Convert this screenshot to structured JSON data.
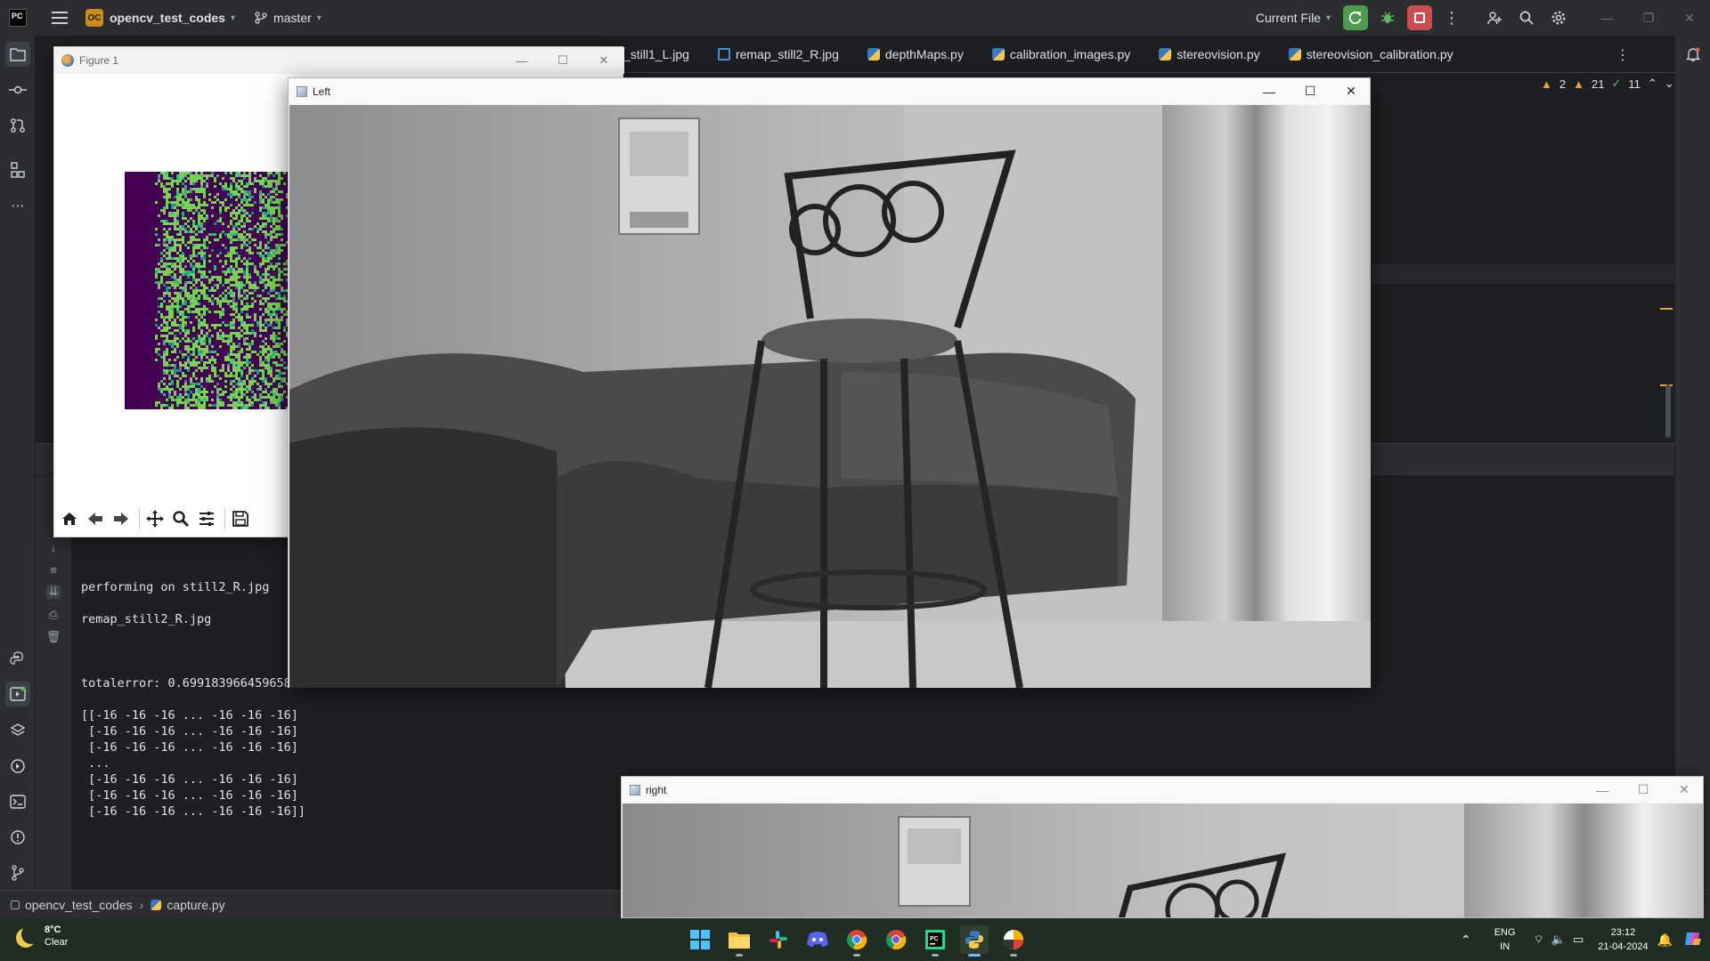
{
  "ide": {
    "logo_text": "PC",
    "project_badge": "OC",
    "project_name": "opencv_test_codes",
    "branch": "master",
    "run_config": "Current File",
    "tabs": [
      {
        "label": "_still1_L.jpg",
        "icon": "image-file-icon"
      },
      {
        "label": "remap_still2_R.jpg",
        "icon": "image-file-icon"
      },
      {
        "label": "depthMaps.py",
        "icon": "python-file-icon"
      },
      {
        "label": "calibration_images.py",
        "icon": "python-file-icon"
      },
      {
        "label": "stereovision.py",
        "icon": "python-file-icon"
      },
      {
        "label": "stereovision_calibration.py",
        "icon": "python-file-icon"
      }
    ],
    "inspections": {
      "warnings_a": "2",
      "warnings_b": "21",
      "ok": "11"
    },
    "project_panel_label": "P",
    "run_panel_label": "R",
    "colors": {
      "bg": "#1e1f22",
      "panel": "#2b2d30",
      "run_green": "#4e9a4e",
      "stop_red": "#c94f4f",
      "accent_warn": "#e5a33b"
    }
  },
  "console": {
    "lines": [
      "performing on still2_R.jpg",
      "",
      "remap_still2_R.jpg",
      "",
      "",
      "",
      "totalerror: 0.6991839664596585",
      "",
      "[[-16 -16 -16 ... -16 -16 -16]",
      " [-16 -16 -16 ... -16 -16 -16]",
      " [-16 -16 -16 ... -16 -16 -16]",
      " ...",
      " [-16 -16 -16 ... -16 -16 -16]",
      " [-16 -16 -16 ... -16 -16 -16]",
      " [-16 -16 -16 ... -16 -16 -16]]"
    ]
  },
  "statusbar": {
    "project": "opencv_test_codes",
    "file": "capture.py"
  },
  "figure": {
    "title": "Figure 1",
    "colors": {
      "bg": "#440154",
      "fg": "#7ad151"
    },
    "tools": [
      "home-icon",
      "back-arrow-icon",
      "forward-arrow-icon",
      "pan-icon",
      "zoom-icon",
      "configure-subplots-icon",
      "save-icon"
    ]
  },
  "left_window": {
    "title": "Left"
  },
  "right_window": {
    "title": "right"
  },
  "taskbar": {
    "weather_temp": "8°C",
    "weather_desc": "Clear",
    "apps": [
      "windows-start-icon",
      "file-explorer-icon",
      "slack-icon",
      "discord-icon",
      "chrome-icon",
      "chrome-profile-icon",
      "pycharm-icon",
      "python-icon",
      "pinwheel-app-icon"
    ],
    "lang_top": "ENG",
    "lang_bottom": "IN",
    "time": "23:12",
    "date": "21-04-2024"
  }
}
